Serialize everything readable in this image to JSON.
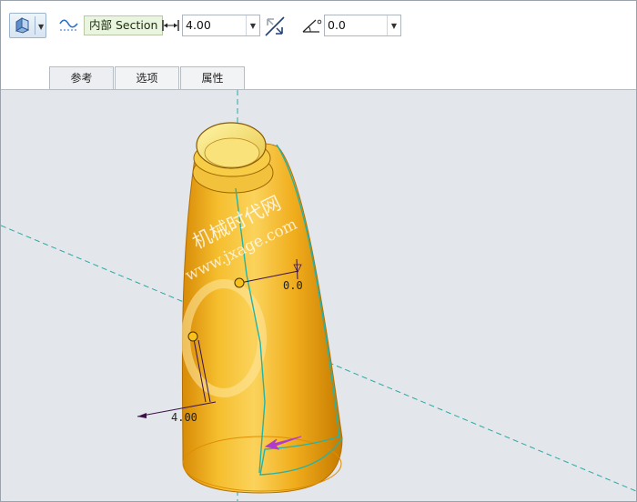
{
  "toolbar": {
    "section_type_label": "内部 Section",
    "offset_value": "4.00",
    "angle_value": "0.0"
  },
  "tabs": [
    {
      "label": "参考"
    },
    {
      "label": "选项"
    },
    {
      "label": "属性"
    }
  ],
  "canvas": {
    "dim_angle_label": "0.0",
    "dim_offset_label": "4.00",
    "watermark_line1": "机械时代网",
    "watermark_line2": "www.jxage.com"
  },
  "colors": {
    "model_fill": "#f2b21f",
    "model_edge": "#c07a00",
    "section_outline": "#25b3a7",
    "datum_axis": "#2aa9a3",
    "dimension": "#3a1248",
    "direction_arrow": "#b13bd1",
    "viewport_bg": "#e3e6eb"
  }
}
